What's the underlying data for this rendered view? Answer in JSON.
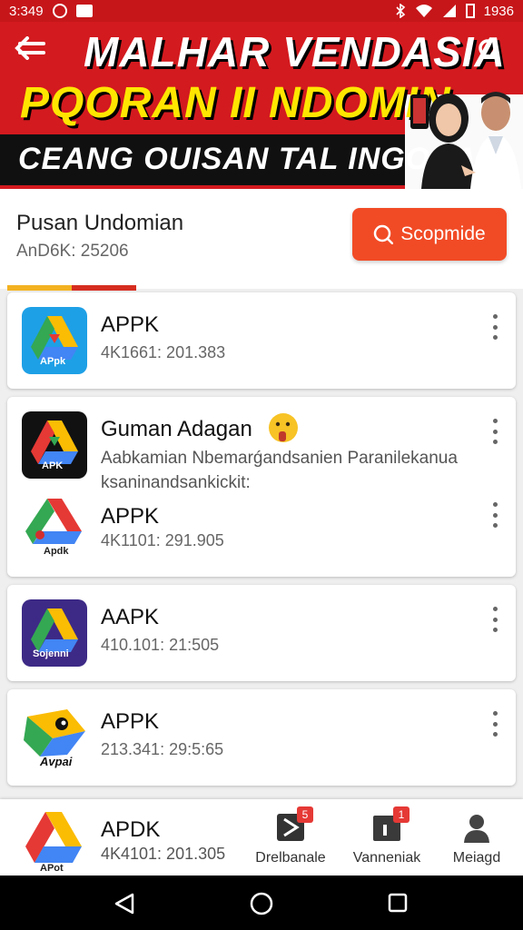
{
  "status_bar": {
    "time": "3:349",
    "clock_right": "1936",
    "icons": [
      "circle-icon",
      "notification-icon",
      "bluetooth-icon",
      "wifi-icon",
      "signal-icon",
      "battery-icon"
    ]
  },
  "hero": {
    "line1": "MALHAR VENDASIA",
    "line2": "PQORAN II NDOMIN",
    "line3": "CEANG OUISAN TAL INGONAS",
    "colors": {
      "red": "#d31a1f",
      "yellow": "#ffe600",
      "black": "#101010"
    }
  },
  "section": {
    "title": "Pusan Undomian",
    "subtitle": "AnD6K: 25206",
    "button_label": "Scopmide",
    "accent": "#f14b26"
  },
  "apps": [
    {
      "name": "APPK",
      "meta": "4K1661: 201.383",
      "icon": "drive-blue-icon",
      "icon_label": "APpk"
    },
    {
      "name": "APPK",
      "meta": "4K1101: 291.905",
      "icon": "drive-white-icon",
      "icon_label": "Apdk"
    },
    {
      "name": "AAPK",
      "meta": "410.101: 21:505",
      "icon": "drive-purple-icon",
      "icon_label": "Sojenni"
    },
    {
      "name": "APPK",
      "meta": "213.341: 29:5:65",
      "icon": "parrot-icon",
      "icon_label": "Avpai"
    }
  ],
  "promo": {
    "title": "Guman Adagan",
    "emoji": "thinking-emoji",
    "description": "Aabkamian Nbemarǵandsanien Paranilekanua ksaninandsankickit:",
    "icon_label": "APK"
  },
  "bottom_app": {
    "name": "APDK",
    "meta": "4K4101: 201.305",
    "icon_label": "APot"
  },
  "bottom_nav": [
    {
      "label": "Drelbanale",
      "icon": "play-box-icon",
      "badge": "5"
    },
    {
      "label": "Vanneniak",
      "icon": "box-icon",
      "badge": "1"
    },
    {
      "label": "Meiagd",
      "icon": "person-icon",
      "badge": ""
    }
  ]
}
